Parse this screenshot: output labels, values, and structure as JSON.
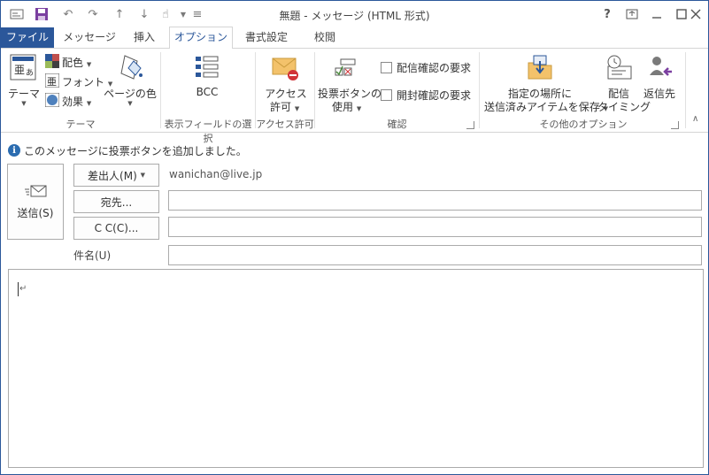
{
  "quick_access": {
    "items": [
      "app-icon",
      "save-icon",
      "undo-icon",
      "redo-icon",
      "up-icon",
      "down-icon",
      "touch-icon",
      "customize-icon"
    ]
  },
  "window": {
    "title": "無題 - メッセージ (HTML 形式)",
    "help": "?"
  },
  "tabs": [
    {
      "label": "ファイル"
    },
    {
      "label": "メッセージ"
    },
    {
      "label": "挿入"
    },
    {
      "label": "オプション"
    },
    {
      "label": "書式設定"
    },
    {
      "label": "校閲"
    }
  ],
  "ribbon": {
    "theme_group": {
      "label": "テーマ",
      "theme_btn": "テーマ",
      "colors": "配色",
      "fonts": "フォント",
      "effects": "効果",
      "page_color": "ページの色"
    },
    "fields_group": {
      "label": "表示フィールドの選択",
      "bcc": "BCC"
    },
    "permission_group": {
      "label": "アクセス許可",
      "line1": "アクセス",
      "line2": "許可"
    },
    "tracking_group": {
      "label": "確認",
      "voting_line1": "投票ボタンの",
      "voting_line2": "使用",
      "delivery": "配信確認の要求",
      "read": "開封確認の要求"
    },
    "more_group": {
      "label": "その他のオプション",
      "save_line1": "指定の場所に",
      "save_line2": "送信済みアイテムを保存",
      "delay_line1": "配信",
      "delay_line2": "タイミング",
      "reply": "返信先"
    }
  },
  "info": {
    "message": "このメッセージに投票ボタンを追加しました。"
  },
  "compose": {
    "send": "送信(S)",
    "from_btn": "差出人(M)",
    "from_value": "wanichan@live.jp",
    "to_btn": "宛先...",
    "cc_btn": "C C(C)...",
    "subject_label": "件名(U)",
    "to_value": "",
    "cc_value": "",
    "subject_value": "",
    "body": "",
    "body_marker": "↵"
  },
  "colors": {
    "accent": "#2b579a",
    "info": "#2b6cb0",
    "border": "#ababab"
  }
}
